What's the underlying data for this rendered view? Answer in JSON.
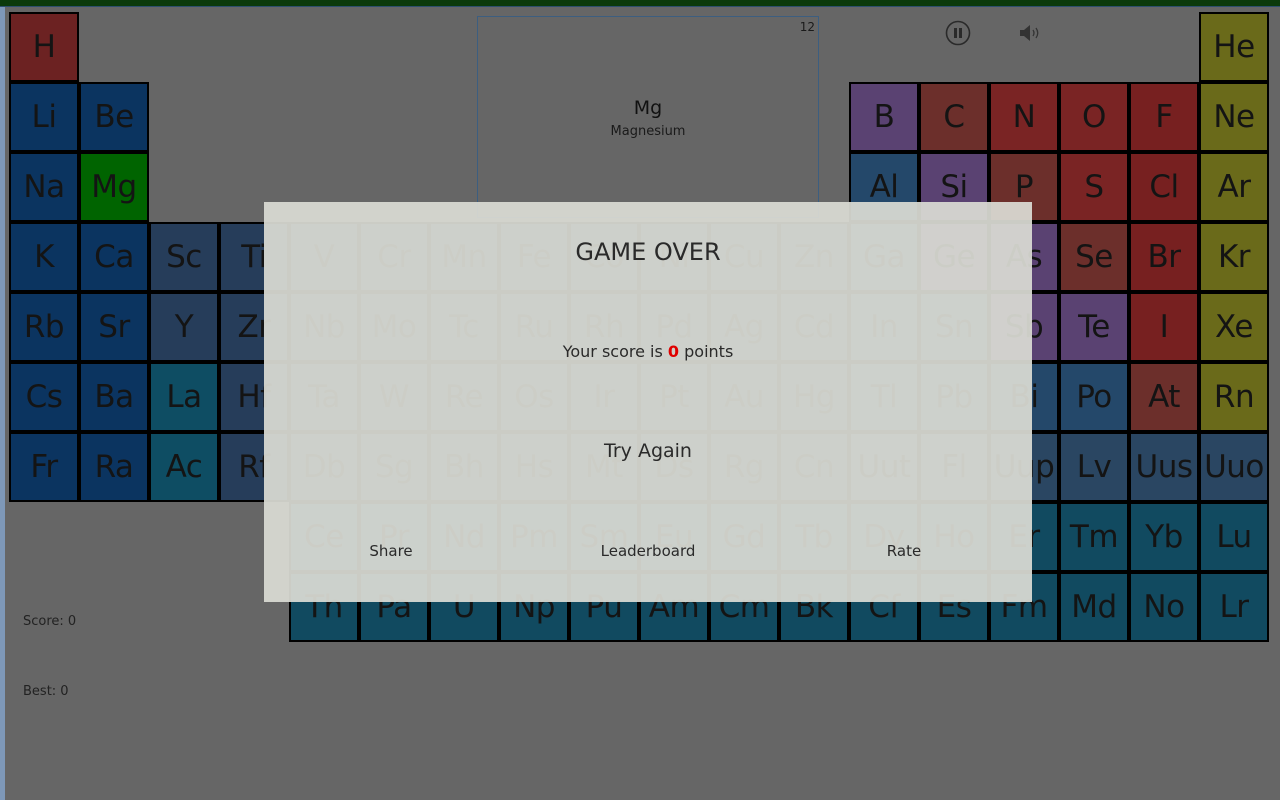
{
  "colors": {
    "background": "#666666",
    "alkali": "#0b3460",
    "alkaline": "#0b3460",
    "transition": "#263d5a",
    "lanthanide": "#114a60",
    "actinide": "#114a60",
    "la_ac": "#0e4d63",
    "post_transition": "#24486a",
    "metalloid": "#5a4272",
    "nonmetal": "#6c2f2b",
    "reactive": "#7a2424",
    "halogen": "#772020",
    "noble": "#6a6a1a",
    "hydrogen": "#6c2222",
    "unknown": "#2a4662",
    "selected": "#006400",
    "score_value": "#e00000"
  },
  "table": {
    "rows": [
      [
        "H",
        null,
        null,
        null,
        null,
        null,
        null,
        null,
        null,
        null,
        null,
        null,
        null,
        null,
        null,
        null,
        null,
        "He"
      ],
      [
        "Li",
        "Be",
        null,
        null,
        null,
        null,
        null,
        null,
        null,
        null,
        null,
        null,
        "B",
        "C",
        "N",
        "O",
        "F",
        "Ne"
      ],
      [
        "Na",
        "Mg",
        null,
        null,
        null,
        null,
        null,
        null,
        null,
        null,
        null,
        null,
        "Al",
        "Si",
        "P",
        "S",
        "Cl",
        "Ar"
      ],
      [
        "K",
        "Ca",
        "Sc",
        "Ti",
        "V",
        "Cr",
        "Mn",
        "Fe",
        "Co",
        "Ni",
        "Cu",
        "Zn",
        "Ga",
        "Ge",
        "As",
        "Se",
        "Br",
        "Kr"
      ],
      [
        "Rb",
        "Sr",
        "Y",
        "Zr",
        "Nb",
        "Mo",
        "Tc",
        "Ru",
        "Rh",
        "Pd",
        "Ag",
        "Cd",
        "In",
        "Sn",
        "Sb",
        "Te",
        "I",
        "Xe"
      ],
      [
        "Cs",
        "Ba",
        "La",
        "Hf",
        "Ta",
        "W",
        "Re",
        "Os",
        "Ir",
        "Pt",
        "Au",
        "Hg",
        "Tl",
        "Pb",
        "Bi",
        "Po",
        "At",
        "Rn"
      ],
      [
        "Fr",
        "Ra",
        "Ac",
        "Rf",
        "Db",
        "Sg",
        "Bh",
        "Hs",
        "Mt",
        "Ds",
        "Rg",
        "Cn",
        "Uut",
        "Fl",
        "Uup",
        "Lv",
        "Uus",
        "Uuo"
      ]
    ],
    "lanthanides": [
      "Ce",
      "Pr",
      "Nd",
      "Pm",
      "Sm",
      "Eu",
      "Gd",
      "Tb",
      "Dy",
      "Ho",
      "Er",
      "Tm",
      "Yb",
      "Lu"
    ],
    "actinides": [
      "Th",
      "Pa",
      "U",
      "Np",
      "Pu",
      "Am",
      "Cm",
      "Bk",
      "Cf",
      "Es",
      "Fm",
      "Md",
      "No",
      "Lr"
    ],
    "selected": "Mg",
    "categories": {
      "hydrogen": [
        "H"
      ],
      "alkali": [
        "Li",
        "Na",
        "K",
        "Rb",
        "Cs",
        "Fr"
      ],
      "alkaline": [
        "Be",
        "Mg",
        "Ca",
        "Sr",
        "Ba",
        "Ra"
      ],
      "la_ac": [
        "La",
        "Ac"
      ],
      "post_transition": [
        "Al",
        "Ga",
        "In",
        "Sn",
        "Tl",
        "Pb",
        "Bi",
        "Po"
      ],
      "metalloid": [
        "B",
        "Si",
        "Ge",
        "As",
        "Sb",
        "Te"
      ],
      "nonmetal": [
        "C",
        "P",
        "Se",
        "At"
      ],
      "reactive": [
        "N",
        "O",
        "S"
      ],
      "halogen": [
        "F",
        "Cl",
        "Br",
        "I"
      ],
      "noble": [
        "He",
        "Ne",
        "Ar",
        "Kr",
        "Xe",
        "Rn"
      ],
      "unknown": [
        "Uut",
        "Fl",
        "Uup",
        "Lv",
        "Uus",
        "Uuo"
      ]
    }
  },
  "info": {
    "number": "12",
    "symbol": "Mg",
    "name": "Magnesium"
  },
  "controls": {
    "pause_icon": "pause-circle-icon",
    "sound_icon": "speaker-icon"
  },
  "stats": {
    "score": "Score: 0",
    "best": "Best: 0"
  },
  "dialog": {
    "title": "GAME OVER",
    "score_prefix": "Your score is ",
    "score_value": "0",
    "score_suffix": " points",
    "try_again": "Try Again",
    "share": "Share",
    "leaderboard": "Leaderboard",
    "rate": "Rate"
  }
}
